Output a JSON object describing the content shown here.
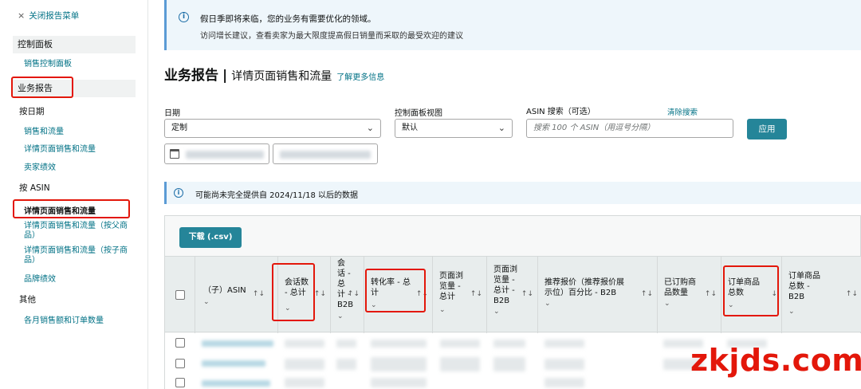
{
  "sidebar": {
    "close_label": "关闭报告菜单",
    "sections": [
      {
        "label": "控制面板"
      },
      {
        "label": "业务报告"
      }
    ],
    "dashboard_link": "销售控制面板",
    "by_date_label": "按日期",
    "by_date_links": [
      "销售和流量",
      "详情页面销售和流量",
      "卖家绩效"
    ],
    "by_asin_label": "按 ASIN",
    "by_asin_active": "详情页面销售和流量",
    "by_asin_links": [
      "详情页面销售和流量（按父商品）",
      "详情页面销售和流量（按子商品）",
      "品牌绩效"
    ],
    "other_label": "其他",
    "other_links": [
      "各月销售额和订单数量"
    ]
  },
  "banner": {
    "line1": "假日季即将来临，您的业务有需要优化的领域。",
    "line2": "访问增长建议，查看卖家为最大限度提高假日销量而采取的最受欢迎的建议"
  },
  "page": {
    "title": "业务报告",
    "separator": "|",
    "subtitle": "详情页面销售和流量",
    "learn_more": "了解更多信息"
  },
  "filters": {
    "date_label": "日期",
    "date_value": "定制",
    "view_label": "控制面板视图",
    "view_value": "默认",
    "asin_label": "ASIN 搜索（可选）",
    "clear_search": "清除搜索",
    "asin_placeholder": "搜索 100 个 ASIN（用逗号分隔）",
    "apply_label": "应用"
  },
  "note": {
    "text": "可能尚未完全提供自 2024/11/18 以后的数据"
  },
  "table": {
    "download_label": "下载 (.csv)",
    "columns": [
      {
        "label": "（子）ASIN",
        "sort": "↑↓"
      },
      {
        "label": "会话数\n- 总计",
        "sort": "↑↓"
      },
      {
        "label": "会\n话 -\n总\n计 -\nB2B",
        "sort": "↑↓"
      },
      {
        "label": "转化率 - 总\n计",
        "sort": "↑↓"
      },
      {
        "label": "页面浏\n览量 -\n总计",
        "sort": "↑↓"
      },
      {
        "label": "页面浏\n览量 -\n总计 -\nB2B",
        "sort": "↑↓"
      },
      {
        "label": "推荐报价（推荐报价展\n示位）百分比 - B2B",
        "sort": "↑↓"
      },
      {
        "label": "已订购商\n品数量",
        "sort": "↑↓"
      },
      {
        "label": "订单商品\n总数",
        "sort": "↓"
      },
      {
        "label": "订单商品\n总数 -\nB2B",
        "sort": "↑↓"
      }
    ]
  },
  "watermark": "zkjds.com",
  "colors": {
    "accent": "#258599",
    "link": "#007185",
    "highlight": "#e3170a",
    "info": "#eef6fb"
  }
}
